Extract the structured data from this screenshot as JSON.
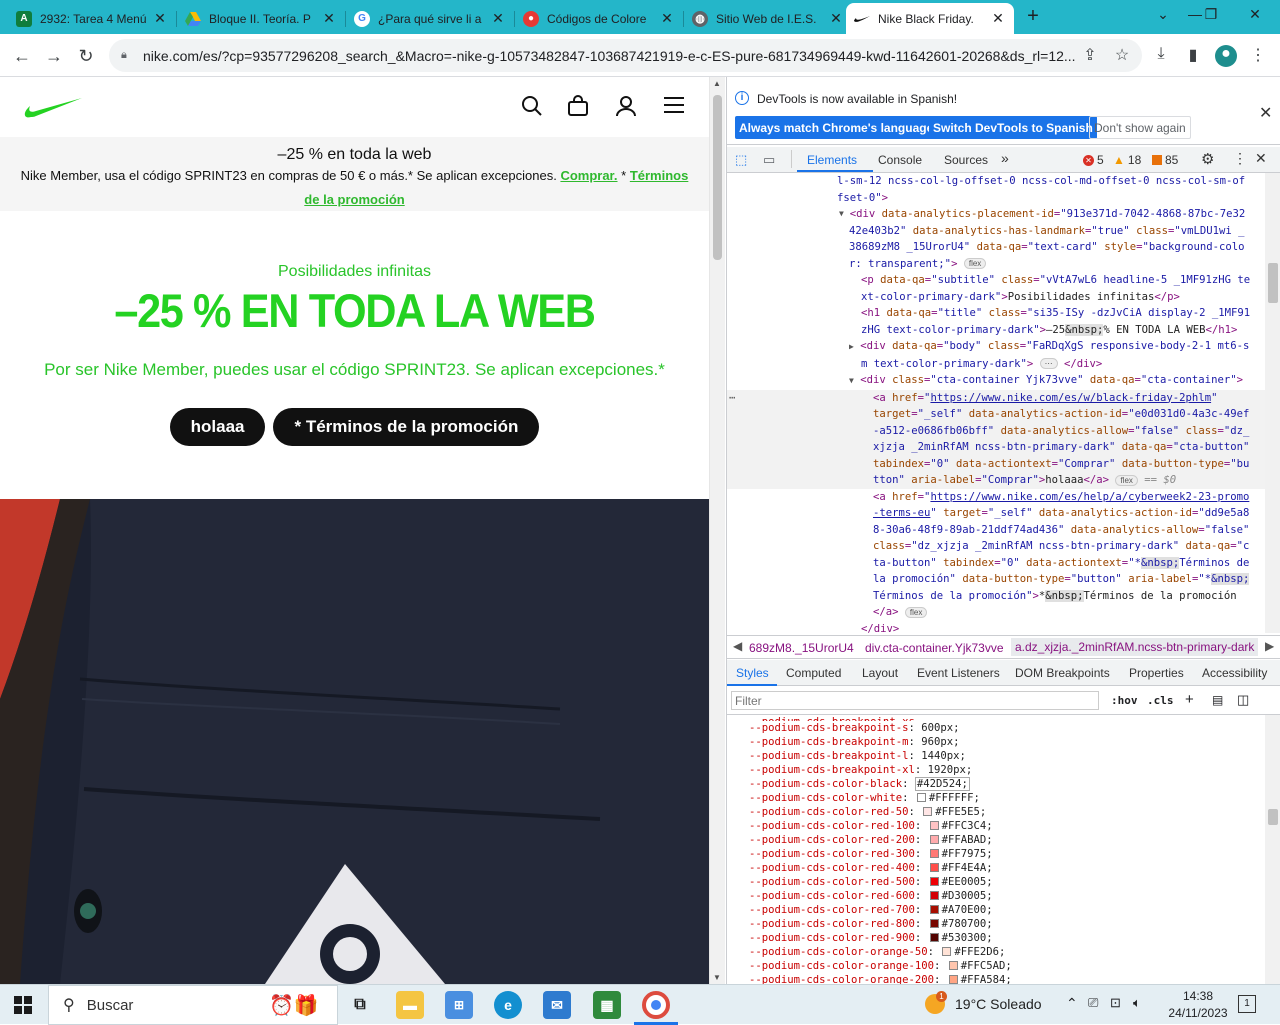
{
  "tabs": [
    {
      "title": "2932: Tarea 4 Menú",
      "icon": "A"
    },
    {
      "title": "Bloque II. Teoría. P",
      "icon": "drive"
    },
    {
      "title": "¿Para qué sirve li a",
      "icon": "G"
    },
    {
      "title": "Códigos de Colore",
      "icon": "o"
    },
    {
      "title": "Sitio Web de I.E.S.",
      "icon": "globe"
    },
    {
      "title": "Nike Black Friday.",
      "icon": "swoosh"
    }
  ],
  "url": "nike.com/es/?cp=93577296208_search_&Macro=-nike-g-10573482847-103687421919-e-c-ES-pure-681734969449-kwd-11642601-20268&ds_rl=12...",
  "nike": {
    "banner_heading": "–25 % en toda la web",
    "banner_text": "Nike Member, usa el código SPRINT23 en compras de 50 € o más.* Se aplican excepciones.",
    "banner_link_buy": "Comprar.",
    "banner_star": "*",
    "banner_link_terms": "Términos de la promoción",
    "hero_subtitle": "Posibilidades infinitas",
    "hero_title": "–25 % EN TODA LA WEB",
    "hero_body": "Por ser Nike Member, puedes usar el código SPRINT23. Se aplican excepciones.*",
    "cta_primary": "holaaa",
    "cta_secondary": "* Términos de la promoción"
  },
  "devtools": {
    "info_message": "DevTools is now available in Spanish!",
    "btn_match": "Always match Chrome's language",
    "btn_switch": "Switch DevTools to Spanish",
    "btn_dont_show": "Don't show again",
    "tabs": [
      "Elements",
      "Console",
      "Sources"
    ],
    "errors": "5",
    "warnings": "18",
    "issues": "85",
    "breadcrumbs": [
      "689zM8._15UrorU4",
      "div.cta-container.Yjk73vve",
      "a.dz_xjzja._2minRfAM.ncss-btn-primary-dark"
    ],
    "style_tabs": [
      "Styles",
      "Computed",
      "Layout",
      "Event Listeners",
      "DOM Breakpoints",
      "Properties",
      "Accessibility"
    ],
    "filter_placeholder": "Filter",
    "filter_hov": ":hov",
    "filter_cls": ".cls",
    "dom_selected_suffix": "== $0",
    "css_vars": [
      {
        "name": "--podium-cds-breakpoint-s",
        "value": "600px;"
      },
      {
        "name": "--podium-cds-breakpoint-m",
        "value": "960px;"
      },
      {
        "name": "--podium-cds-breakpoint-l",
        "value": "1440px;"
      },
      {
        "name": "--podium-cds-breakpoint-xl",
        "value": "1920px;"
      },
      {
        "name": "--podium-cds-color-black",
        "value": "#42D524;",
        "swatch": ""
      },
      {
        "name": "--podium-cds-color-white",
        "value": "#FFFFFF;",
        "swatch": "#FFFFFF"
      },
      {
        "name": "--podium-cds-color-red-50",
        "value": "#FFE5E5;",
        "swatch": "#FFE5E5"
      },
      {
        "name": "--podium-cds-color-red-100",
        "value": "#FFC3C4;",
        "swatch": "#FFC3C4"
      },
      {
        "name": "--podium-cds-color-red-200",
        "value": "#FFABAD;",
        "swatch": "#FFABAD"
      },
      {
        "name": "--podium-cds-color-red-300",
        "value": "#FF7975;",
        "swatch": "#FF7975"
      },
      {
        "name": "--podium-cds-color-red-400",
        "value": "#FF4E4A;",
        "swatch": "#FF4E4A"
      },
      {
        "name": "--podium-cds-color-red-500",
        "value": "#EE0005;",
        "swatch": "#EE0005"
      },
      {
        "name": "--podium-cds-color-red-600",
        "value": "#D30005;",
        "swatch": "#D30005"
      },
      {
        "name": "--podium-cds-color-red-700",
        "value": "#A70E00;",
        "swatch": "#A70E00"
      },
      {
        "name": "--podium-cds-color-red-800",
        "value": "#780700;",
        "swatch": "#780700"
      },
      {
        "name": "--podium-cds-color-red-900",
        "value": "#530300;",
        "swatch": "#530300"
      },
      {
        "name": "--podium-cds-color-orange-50",
        "value": "#FFE2D6;",
        "swatch": "#FFE2D6"
      },
      {
        "name": "--podium-cds-color-orange-100",
        "value": "#FFC5AD;",
        "swatch": "#FFC5AD"
      },
      {
        "name": "--podium-cds-color-orange-200",
        "value": "#FFA584;",
        "swatch": "#FFA584"
      }
    ]
  },
  "taskbar": {
    "search_placeholder": "Buscar",
    "weather": "19°C  Soleado",
    "weather_badge": "1",
    "time": "14:38",
    "date": "24/11/2023",
    "notifications": "1"
  },
  "colors": {
    "tabstrip": "#24b6c9",
    "nike_green": "#24d222",
    "devtools_blue": "#1a73e8"
  }
}
